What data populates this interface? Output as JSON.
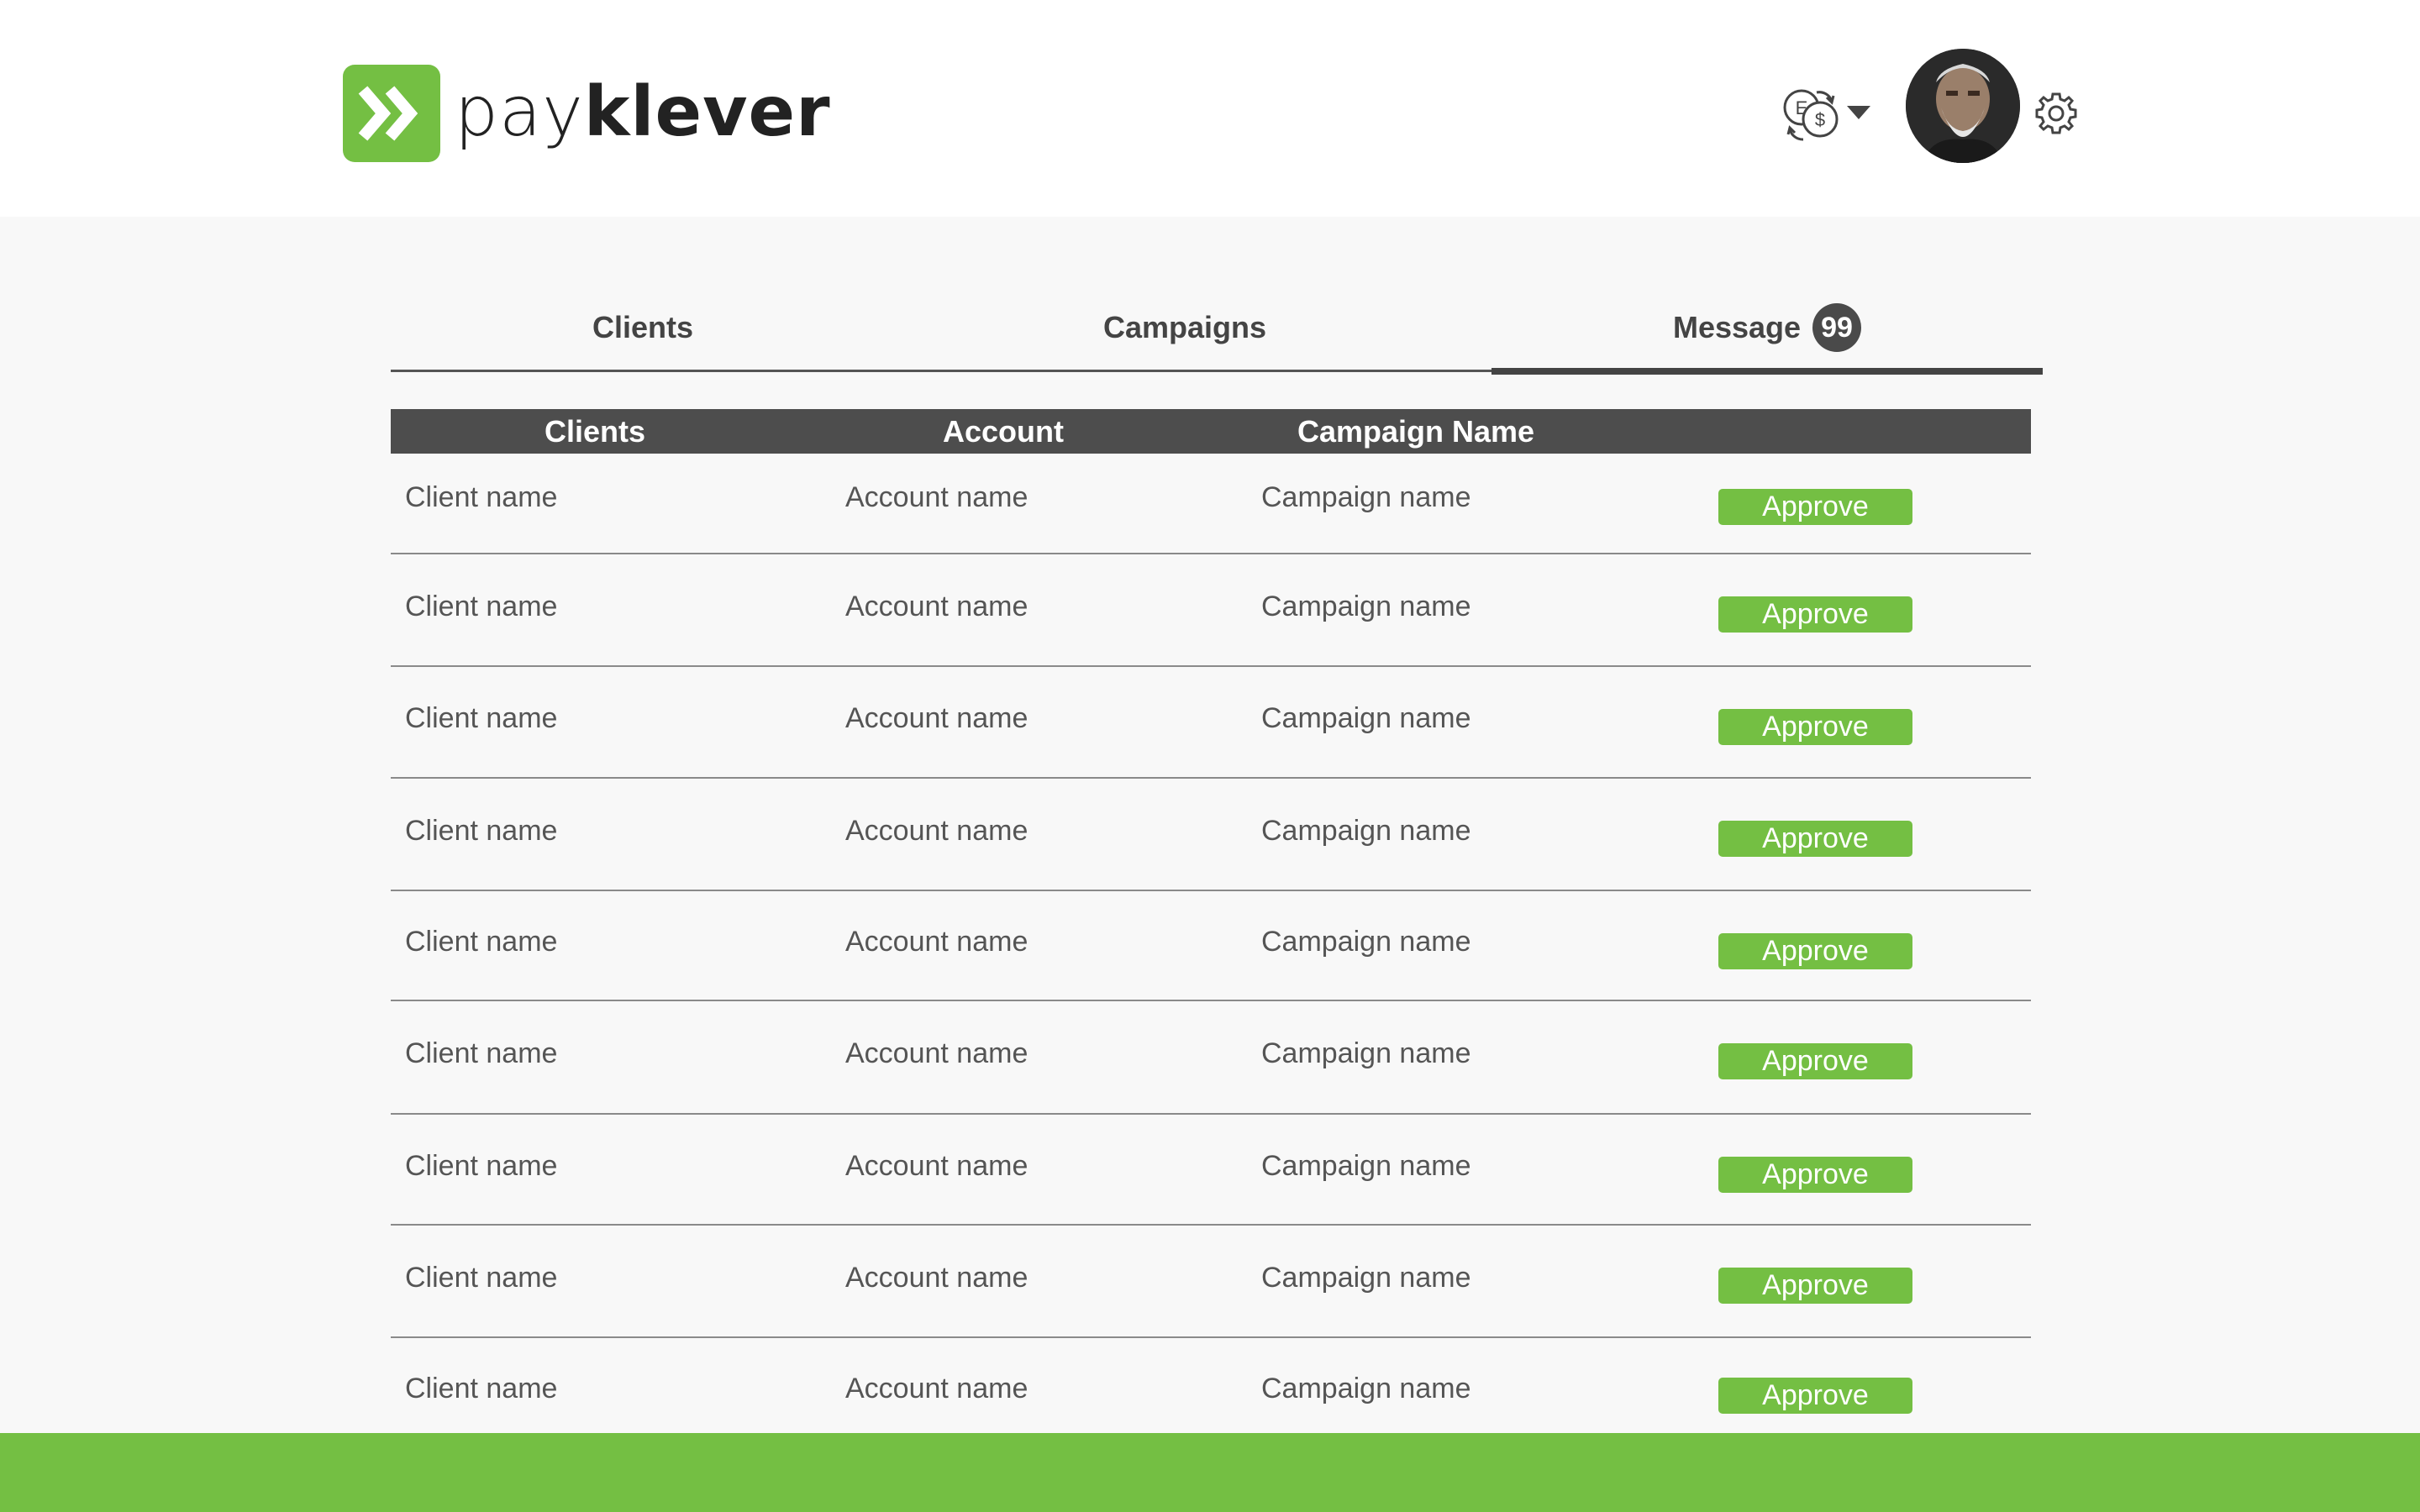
{
  "brand": {
    "name_light": "pay",
    "name_bold": "klever",
    "logo_icon": "double-chevron-right-icon",
    "accent_color": "#74bf43"
  },
  "header": {
    "currency_icon": "currency-exchange-icon",
    "dropdown_icon": "caret-down-icon",
    "avatar_icon": "user-avatar",
    "settings_icon": "gear-icon"
  },
  "tabs": [
    {
      "label": "Clients",
      "active": false
    },
    {
      "label": "Campaigns",
      "active": false
    },
    {
      "label": "Message",
      "active": true,
      "badge": "99"
    }
  ],
  "table": {
    "headers": [
      "Clients",
      "Account",
      "Campaign Name",
      ""
    ],
    "rows": [
      {
        "client": "Client name",
        "account": "Account name",
        "campaign": "Campaign name",
        "action": "Approve"
      },
      {
        "client": "Client name",
        "account": "Account name",
        "campaign": "Campaign name",
        "action": "Approve"
      },
      {
        "client": "Client name",
        "account": "Account name",
        "campaign": "Campaign name",
        "action": "Approve"
      },
      {
        "client": "Client name",
        "account": "Account name",
        "campaign": "Campaign name",
        "action": "Approve"
      },
      {
        "client": "Client name",
        "account": "Account name",
        "campaign": "Campaign name",
        "action": "Approve"
      },
      {
        "client": "Client name",
        "account": "Account name",
        "campaign": "Campaign name",
        "action": "Approve"
      },
      {
        "client": "Client name",
        "account": "Account name",
        "campaign": "Campaign name",
        "action": "Approve"
      },
      {
        "client": "Client name",
        "account": "Account name",
        "campaign": "Campaign name",
        "action": "Approve"
      },
      {
        "client": "Client name",
        "account": "Account name",
        "campaign": "Campaign name",
        "action": "Approve"
      }
    ]
  }
}
